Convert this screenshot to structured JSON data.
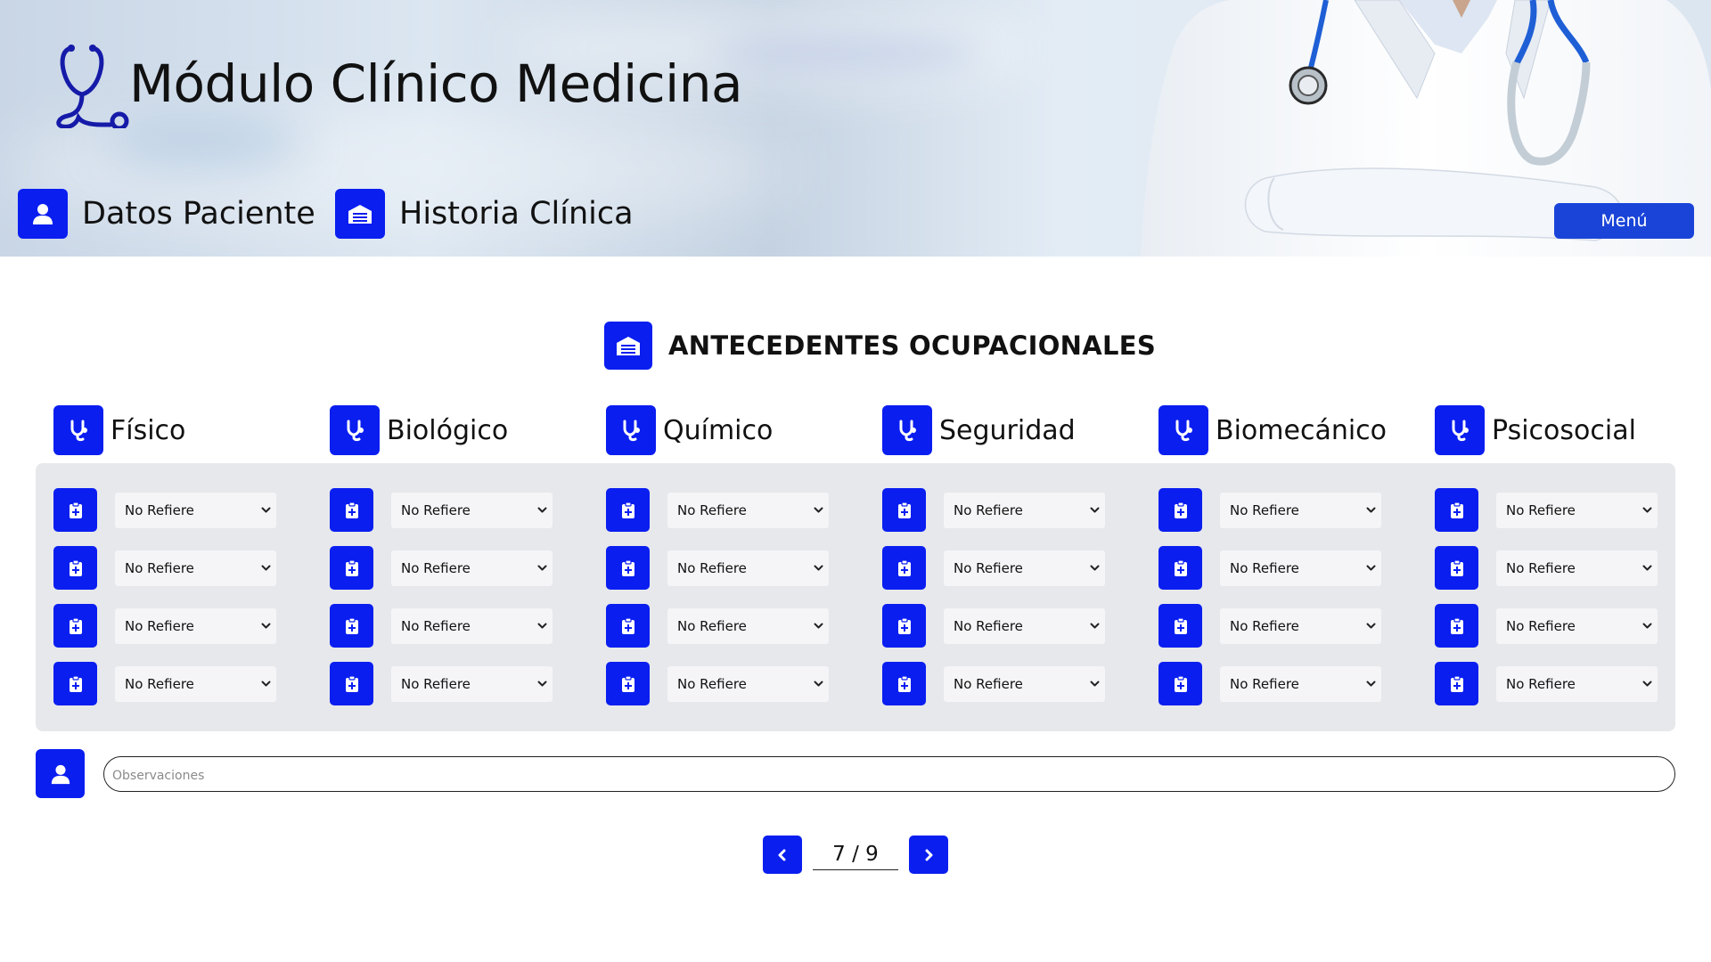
{
  "app": {
    "title": "Módulo Clínico Medicina",
    "logo_icon": "stethoscope-icon"
  },
  "nav": {
    "patient_label": "Datos Paciente",
    "patient_icon": "user-icon",
    "history_label": "Historia Clínica",
    "history_icon": "hospital-icon",
    "menu_label": "Menú"
  },
  "section": {
    "title": "ANTECEDENTES OCUPACIONALES",
    "icon": "hospital-icon"
  },
  "categories": [
    {
      "label": "Físico",
      "icon": "stethoscope-icon"
    },
    {
      "label": "Biológico",
      "icon": "stethoscope-icon"
    },
    {
      "label": "Químico",
      "icon": "stethoscope-icon"
    },
    {
      "label": "Seguridad",
      "icon": "stethoscope-icon"
    },
    {
      "label": "Biomecánico",
      "icon": "stethoscope-icon"
    },
    {
      "label": "Psicosocial",
      "icon": "stethoscope-icon"
    }
  ],
  "grid": {
    "row_icon": "clipboard-medical-icon",
    "selects": [
      [
        "No Refiere",
        "No Refiere",
        "No Refiere",
        "No Refiere"
      ],
      [
        "No Refiere",
        "No Refiere",
        "No Refiere",
        "No Refiere"
      ],
      [
        "No Refiere",
        "No Refiere",
        "No Refiere",
        "No Refiere"
      ],
      [
        "No Refiere",
        "No Refiere",
        "No Refiere",
        "No Refiere"
      ],
      [
        "No Refiere",
        "No Refiere",
        "No Refiere",
        "No Refiere"
      ],
      [
        "No Refiere",
        "No Refiere",
        "No Refiere",
        "No Refiere"
      ]
    ]
  },
  "observations": {
    "placeholder": "Observaciones",
    "value": "",
    "icon": "user-icon"
  },
  "pagination": {
    "indicator": "7 / 9",
    "current": 7,
    "total": 9
  },
  "colors": {
    "accent": "#0a1ef0",
    "menu_button": "#1a44d8",
    "panel_bg": "#e7e8ec",
    "select_bg": "#f5f5f7"
  }
}
